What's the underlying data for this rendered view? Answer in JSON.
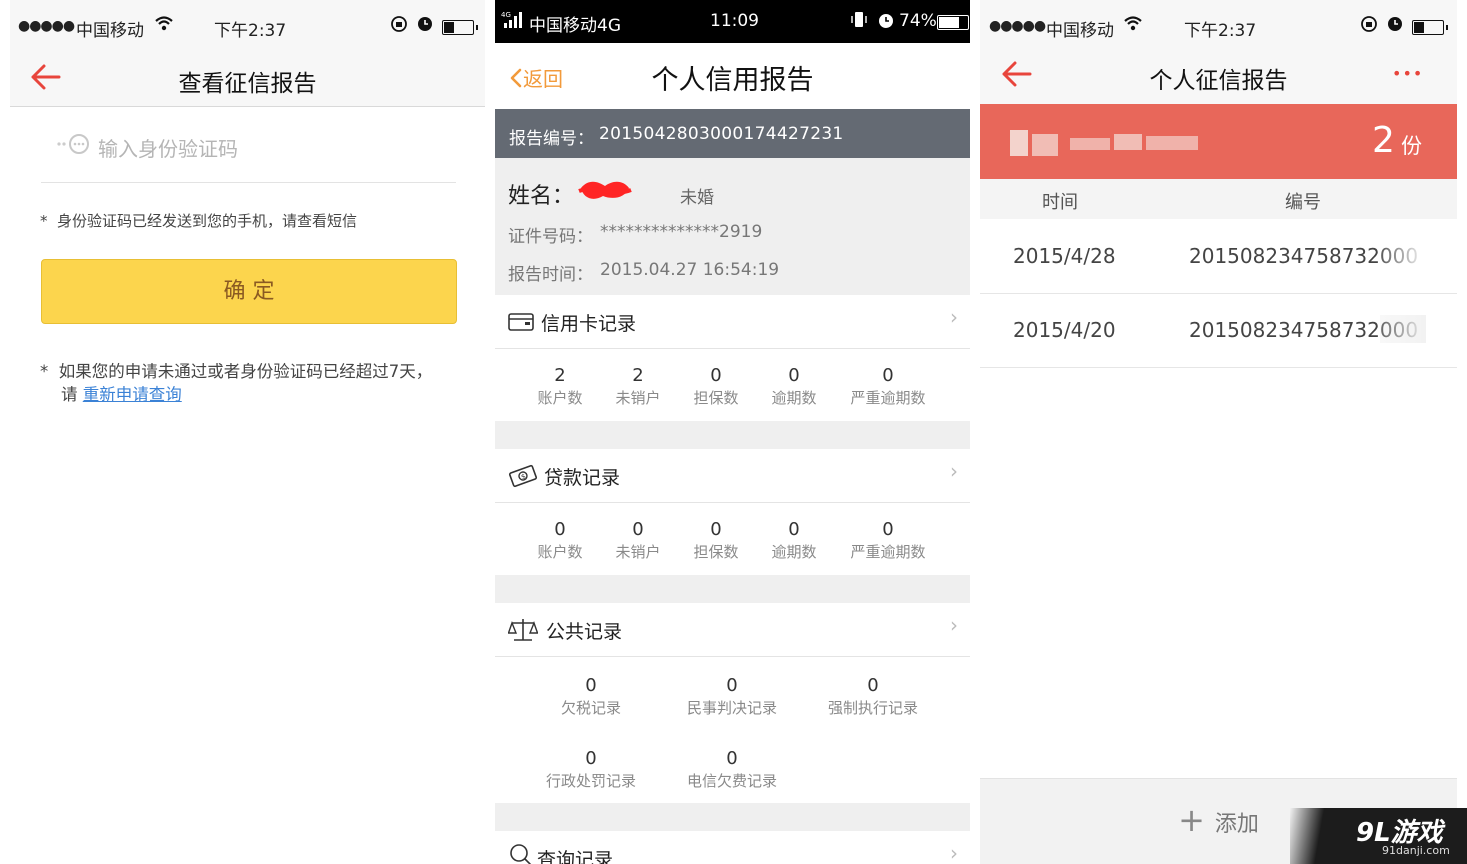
{
  "panel1": {
    "status": {
      "carrier": "中国移动",
      "time": "下午2:37"
    },
    "title": "查看征信报告",
    "input_placeholder": "输入身份验证码",
    "note1": "身份验证码已经发送到您的手机，请查看短信",
    "confirm_label": "确 定",
    "note2": "如果您的申请未通过或者身份验证码已经超过7天，",
    "note2b_prefix": "请 ",
    "reapply_link": "重新申请查询",
    "asterisk": "*"
  },
  "panel2": {
    "status": {
      "net": "4G",
      "carrier": "中国移动4G",
      "time": "11:09",
      "battery": "74%"
    },
    "back_label": "返回",
    "title": "个人信用报告",
    "report_no_label": "报告编号：",
    "report_no": "2015042803000174427231",
    "name_label": "姓名：",
    "marital": "未婚",
    "id_label": "证件号码：",
    "id_value": "**************2919",
    "time_label": "报告时间：",
    "time_value": "2015.04.27 16:54:19",
    "credit_card": {
      "title": "信用卡记录",
      "stats": [
        {
          "value": "2",
          "label": "账户数"
        },
        {
          "value": "2",
          "label": "未销户"
        },
        {
          "value": "0",
          "label": "担保数"
        },
        {
          "value": "0",
          "label": "逾期数"
        },
        {
          "value": "0",
          "label": "严重逾期数"
        }
      ]
    },
    "loan": {
      "title": "贷款记录",
      "stats": [
        {
          "value": "0",
          "label": "账户数"
        },
        {
          "value": "0",
          "label": "未销户"
        },
        {
          "value": "0",
          "label": "担保数"
        },
        {
          "value": "0",
          "label": "逾期数"
        },
        {
          "value": "0",
          "label": "严重逾期数"
        }
      ]
    },
    "public": {
      "title": "公共记录",
      "stats": [
        {
          "value": "0",
          "label": "欠税记录"
        },
        {
          "value": "0",
          "label": "民事判决记录"
        },
        {
          "value": "0",
          "label": "强制执行记录"
        },
        {
          "value": "0",
          "label": "行政处罚记录"
        },
        {
          "value": "0",
          "label": "电信欠费记录"
        }
      ]
    },
    "query_title": "查询记录"
  },
  "panel3": {
    "status": {
      "carrier": "中国移动",
      "time": "下午2:37"
    },
    "title": "个人征信报告",
    "more": "•••",
    "count": "2",
    "count_unit": "份",
    "col_time": "时间",
    "col_no": "编号",
    "rows": [
      {
        "date": "2015/4/28",
        "number": "201508234758732000"
      },
      {
        "date": "2015/4/20",
        "number": "201508234758732000"
      }
    ],
    "add_label": "添加"
  },
  "watermark": {
    "brand": "9L游戏",
    "site": "91danji.com"
  },
  "colors": {
    "accent_red": "#e8453c",
    "banner_red": "#e8675a",
    "yellow": "#fcd54d",
    "link_blue": "#3b82d6",
    "orange": "#f29a3b",
    "grey_bar": "#646a73"
  }
}
